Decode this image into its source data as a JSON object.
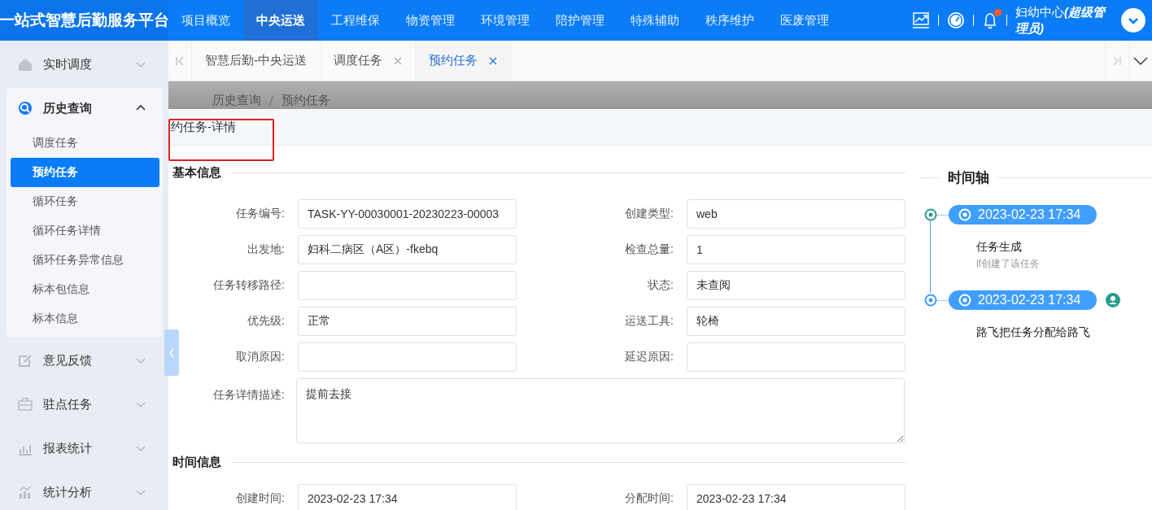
{
  "header": {
    "logo": "一站式智慧后勤服务平台",
    "nav": [
      {
        "label": "项目概览",
        "selected": false
      },
      {
        "label": "中央运送",
        "selected": true
      },
      {
        "label": "工程维保",
        "selected": false
      },
      {
        "label": "物资管理",
        "selected": false
      },
      {
        "label": "环境管理",
        "selected": false
      },
      {
        "label": "陪护管理",
        "selected": false
      },
      {
        "label": "特殊辅助",
        "selected": false
      },
      {
        "label": "秩序维护",
        "selected": false
      },
      {
        "label": "医废管理",
        "selected": false
      }
    ],
    "notification_badge": true,
    "user": {
      "name": "妇幼中心",
      "role": "(超级管理员)"
    }
  },
  "sidebar": {
    "items": [
      {
        "label": "实时调度",
        "expanded": false
      },
      {
        "label": "历史查询",
        "expanded": true,
        "children": [
          {
            "label": "调度任务",
            "selected": false
          },
          {
            "label": "预约任务",
            "selected": true
          },
          {
            "label": "循环任务",
            "selected": false
          },
          {
            "label": "循环任务详情",
            "selected": false
          },
          {
            "label": "循环任务异常信息",
            "selected": false
          },
          {
            "label": "标本包信息",
            "selected": false
          },
          {
            "label": "标本信息",
            "selected": false
          }
        ]
      },
      {
        "label": "意见反馈",
        "expanded": false
      },
      {
        "label": "驻点任务",
        "expanded": false
      },
      {
        "label": "报表统计",
        "expanded": false
      },
      {
        "label": "统计分析",
        "expanded": false
      }
    ]
  },
  "tabs": [
    {
      "label": "智慧后勤-中央运送",
      "closable": false,
      "selected": false
    },
    {
      "label": "调度任务",
      "closable": true,
      "selected": false
    },
    {
      "label": "预约任务",
      "closable": true,
      "selected": true
    }
  ],
  "breadcrumb": [
    "历史查询",
    "预约任务"
  ],
  "panel_title": "约任务-详情",
  "sections": [
    {
      "title": "基本信息",
      "fields": [
        {
          "label": "任务编号:",
          "value": "TASK-YY-00030001-20230223-00003",
          "kind": "input"
        },
        {
          "label": "创建类型:",
          "value": "web",
          "kind": "input"
        },
        {
          "label": "出发地:",
          "value": "妇科二病区（A区）-fkebq",
          "kind": "input"
        },
        {
          "label": "检查总量:",
          "value": "1",
          "kind": "input"
        },
        {
          "label": "任务转移路径:",
          "kind": "input"
        },
        {
          "label": "状态:",
          "value": "未查阅",
          "kind": "input"
        },
        {
          "label": "优先级:",
          "value": "正常",
          "kind": "input"
        },
        {
          "label": "运送工具:",
          "value": "轮椅",
          "kind": "input"
        },
        {
          "label": "取消原因:",
          "kind": "input"
        },
        {
          "label": "延迟原因:",
          "kind": "input"
        },
        {
          "label": "任务详情描述:",
          "value": "提前去接",
          "kind": "textarea"
        }
      ]
    },
    {
      "title": "时间信息",
      "fields": [
        {
          "label": "创建时间:",
          "value": "2023-02-23 17:34",
          "kind": "input"
        },
        {
          "label": "分配时间:",
          "value": "2023-02-23 17:34",
          "kind": "input"
        }
      ]
    }
  ],
  "timeline": {
    "title": "时间轴",
    "events": [
      {
        "time": "2023-02-23 17:34",
        "title": "任务生成",
        "subtitle": "lf创建了该任务",
        "color": "#2a9d8f",
        "avatar": false
      },
      {
        "time": "2023-02-23 17:34",
        "title": "路飞把任务分配给路飞",
        "color": "#409eff",
        "avatar": true
      }
    ]
  }
}
